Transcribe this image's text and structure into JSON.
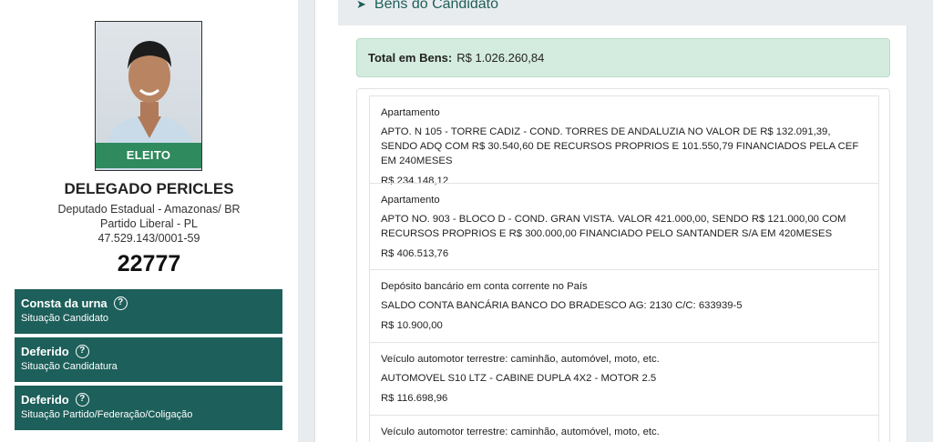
{
  "candidate": {
    "photo_badge": "ELEITO",
    "name": "DELEGADO PERICLES",
    "office": "Deputado Estadual - Amazonas/ BR",
    "party": "Partido Liberal - PL",
    "cnpj": "47.529.143/0001-59",
    "number": "22777"
  },
  "statuses": [
    {
      "title": "Consta da urna",
      "subtitle": "Situação Candidato"
    },
    {
      "title": "Deferido",
      "subtitle": "Situação Candidatura"
    },
    {
      "title": "Deferido",
      "subtitle": "Situação Partido/Federação/Coligação"
    }
  ],
  "assets": {
    "section_title": "Bens do Candidato",
    "total_label": "Total em Bens:",
    "total_value": "R$ 1.026.260,84",
    "items": [
      {
        "type": "Apartamento",
        "description": "APTO. N 105 - TORRE CADIZ - COND. TORRES DE ANDALUZIA NO VALOR DE R$ 132.091,39, SENDO ADQ COM R$ 30.540,60 DE RECURSOS PROPRIOS E 101.550,79 FINANCIADOS PELA CEF EM 240MESES",
        "value": "R$ 234.148,12"
      },
      {
        "type": "Apartamento",
        "description": "APTO NO. 903 - BLOCO D - COND. GRAN VISTA. VALOR 421.000,00, SENDO R$ 121.000,00 COM RECURSOS PROPRIOS E R$ 300.000,00 FINANCIADO PELO SANTANDER S/A EM 420MESES",
        "value": "R$ 406.513,76"
      },
      {
        "type": "Depósito bancário em conta corrente no País",
        "description": "SALDO CONTA BANCÁRIA BANCO DO BRADESCO AG: 2130 C/C: 633939-5",
        "value": "R$ 10.900,00"
      },
      {
        "type": "Veículo automotor terrestre: caminhão, automóvel, moto, etc.",
        "description": "AUTOMOVEL S10 LTZ - CABINE DUPLA 4X2 - MOTOR 2.5",
        "value": "R$ 116.698,96"
      },
      {
        "type": "Veículo automotor terrestre: caminhão, automóvel, moto, etc."
      }
    ]
  },
  "icons": {
    "section": "rocket-icon",
    "collapse": "chevron-up-icon",
    "help": "question-circle-icon"
  },
  "colors": {
    "accent": "#1d5f5a",
    "elected_badge": "#2f8a5e",
    "total_bg": "#d4ecdf"
  }
}
